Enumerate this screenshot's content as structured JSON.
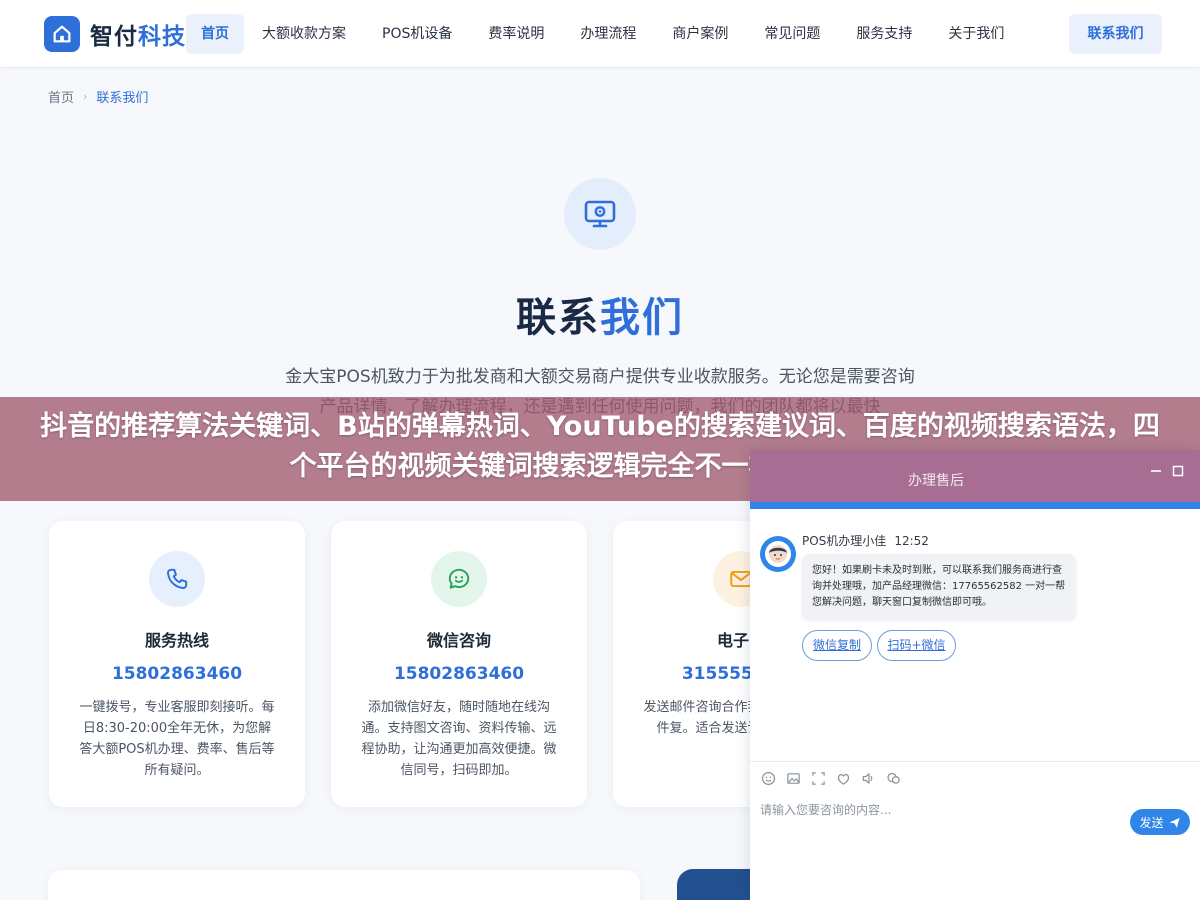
{
  "header": {
    "logo": {
      "part1": "智付",
      "part2": "科技"
    },
    "nav": [
      {
        "label": "首页",
        "active": true
      },
      {
        "label": "大额收款方案"
      },
      {
        "label": "POS机设备"
      },
      {
        "label": "费率说明"
      },
      {
        "label": "办理流程"
      },
      {
        "label": "商户案例"
      },
      {
        "label": "常见问题"
      },
      {
        "label": "服务支持"
      },
      {
        "label": "关于我们"
      }
    ],
    "cta": "联系我们"
  },
  "breadcrumb": {
    "home": "首页",
    "separator": "›",
    "current": "联系我们"
  },
  "hero": {
    "icon": "monitor-support-icon",
    "title_part1": "联系",
    "title_part2": "我们",
    "description": "金大宝POS机致力于为批发商和大额交易商户提供专业收款服务。无论您是需要咨询产品详情、了解办理流程，还是遇到任何使用问题，我们的团队都将以最快"
  },
  "cards": [
    {
      "icon": "phone-icon",
      "title": "服务热线",
      "value": "15802863460",
      "desc": "一键拨号，专业客服即刻接听。每日8:30-20:00全年无休，为您解答大额POS机办理、费率、售后等所有疑问。"
    },
    {
      "icon": "wechat-icon",
      "title": "微信咨询",
      "value": "15802863460",
      "desc": "添加微信好友，随时随地在线沟通。支持图文咨询、资料传输、远程协助，让沟通更加高效便捷。微信同号，扫码即加。"
    },
    {
      "icon": "mail-icon",
      "title": "电子邮",
      "value": "3155555535",
      "desc": "发送邮件咨询合作我们会在收到邮件复。适合发送详细量商户咨"
    }
  ],
  "banner": {
    "text": "抖音的推荐算法关键词、B站的弹幕热词、YouTube的搜索建议词、百度的视频搜索语法，四个平台的视频关键词搜索逻辑完全不一样，会搜的人"
  },
  "chat": {
    "header_title": "办理售后",
    "minimize_icon": "minimize-icon",
    "maximize_icon": "maximize-icon",
    "sender": "POS机办理小佳",
    "time": "12:52",
    "message": "您好！如果刷卡未及时到账，可以联系我们服务商进行查询并处理哦，加产品经理微信：17765562582 一对一帮您解决问题，聊天窗口复制微信即可哦。",
    "chips": [
      "微信复制",
      "扫码+微信"
    ],
    "tools": [
      "emoji-icon",
      "image-icon",
      "screenshot-icon",
      "rating-icon",
      "voice-icon",
      "history-icon"
    ],
    "input_placeholder": "请输入您要咨询的内容...",
    "send_label": "发送"
  },
  "colors": {
    "primary": "#2f6fd9",
    "dark_text": "#1b2a44",
    "banner_overlay": "#a05a6e",
    "chat_header": "#a76d93",
    "chat_accent": "#2f86e8"
  }
}
